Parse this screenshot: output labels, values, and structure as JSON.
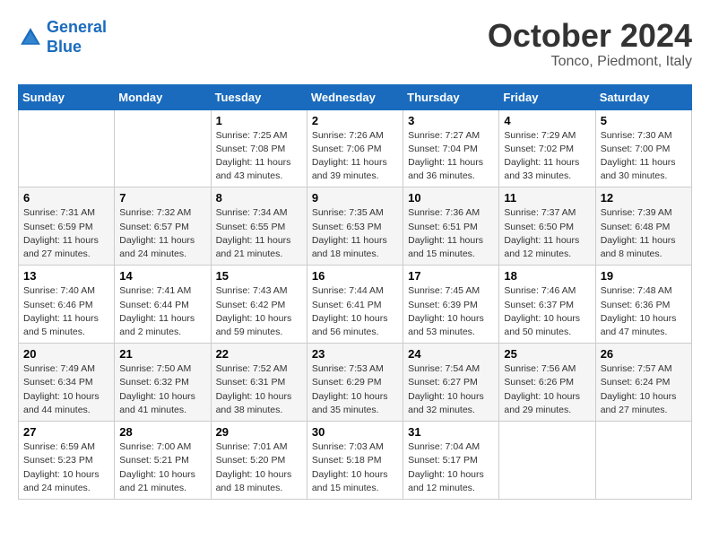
{
  "header": {
    "logo": {
      "line1": "General",
      "line2": "Blue"
    },
    "title": "October 2024",
    "location": "Tonco, Piedmont, Italy"
  },
  "weekdays": [
    "Sunday",
    "Monday",
    "Tuesday",
    "Wednesday",
    "Thursday",
    "Friday",
    "Saturday"
  ],
  "weeks": [
    [
      {
        "day": "",
        "info": ""
      },
      {
        "day": "",
        "info": ""
      },
      {
        "day": "1",
        "info": "Sunrise: 7:25 AM\nSunset: 7:08 PM\nDaylight: 11 hours and 43 minutes."
      },
      {
        "day": "2",
        "info": "Sunrise: 7:26 AM\nSunset: 7:06 PM\nDaylight: 11 hours and 39 minutes."
      },
      {
        "day": "3",
        "info": "Sunrise: 7:27 AM\nSunset: 7:04 PM\nDaylight: 11 hours and 36 minutes."
      },
      {
        "day": "4",
        "info": "Sunrise: 7:29 AM\nSunset: 7:02 PM\nDaylight: 11 hours and 33 minutes."
      },
      {
        "day": "5",
        "info": "Sunrise: 7:30 AM\nSunset: 7:00 PM\nDaylight: 11 hours and 30 minutes."
      }
    ],
    [
      {
        "day": "6",
        "info": "Sunrise: 7:31 AM\nSunset: 6:59 PM\nDaylight: 11 hours and 27 minutes."
      },
      {
        "day": "7",
        "info": "Sunrise: 7:32 AM\nSunset: 6:57 PM\nDaylight: 11 hours and 24 minutes."
      },
      {
        "day": "8",
        "info": "Sunrise: 7:34 AM\nSunset: 6:55 PM\nDaylight: 11 hours and 21 minutes."
      },
      {
        "day": "9",
        "info": "Sunrise: 7:35 AM\nSunset: 6:53 PM\nDaylight: 11 hours and 18 minutes."
      },
      {
        "day": "10",
        "info": "Sunrise: 7:36 AM\nSunset: 6:51 PM\nDaylight: 11 hours and 15 minutes."
      },
      {
        "day": "11",
        "info": "Sunrise: 7:37 AM\nSunset: 6:50 PM\nDaylight: 11 hours and 12 minutes."
      },
      {
        "day": "12",
        "info": "Sunrise: 7:39 AM\nSunset: 6:48 PM\nDaylight: 11 hours and 8 minutes."
      }
    ],
    [
      {
        "day": "13",
        "info": "Sunrise: 7:40 AM\nSunset: 6:46 PM\nDaylight: 11 hours and 5 minutes."
      },
      {
        "day": "14",
        "info": "Sunrise: 7:41 AM\nSunset: 6:44 PM\nDaylight: 11 hours and 2 minutes."
      },
      {
        "day": "15",
        "info": "Sunrise: 7:43 AM\nSunset: 6:42 PM\nDaylight: 10 hours and 59 minutes."
      },
      {
        "day": "16",
        "info": "Sunrise: 7:44 AM\nSunset: 6:41 PM\nDaylight: 10 hours and 56 minutes."
      },
      {
        "day": "17",
        "info": "Sunrise: 7:45 AM\nSunset: 6:39 PM\nDaylight: 10 hours and 53 minutes."
      },
      {
        "day": "18",
        "info": "Sunrise: 7:46 AM\nSunset: 6:37 PM\nDaylight: 10 hours and 50 minutes."
      },
      {
        "day": "19",
        "info": "Sunrise: 7:48 AM\nSunset: 6:36 PM\nDaylight: 10 hours and 47 minutes."
      }
    ],
    [
      {
        "day": "20",
        "info": "Sunrise: 7:49 AM\nSunset: 6:34 PM\nDaylight: 10 hours and 44 minutes."
      },
      {
        "day": "21",
        "info": "Sunrise: 7:50 AM\nSunset: 6:32 PM\nDaylight: 10 hours and 41 minutes."
      },
      {
        "day": "22",
        "info": "Sunrise: 7:52 AM\nSunset: 6:31 PM\nDaylight: 10 hours and 38 minutes."
      },
      {
        "day": "23",
        "info": "Sunrise: 7:53 AM\nSunset: 6:29 PM\nDaylight: 10 hours and 35 minutes."
      },
      {
        "day": "24",
        "info": "Sunrise: 7:54 AM\nSunset: 6:27 PM\nDaylight: 10 hours and 32 minutes."
      },
      {
        "day": "25",
        "info": "Sunrise: 7:56 AM\nSunset: 6:26 PM\nDaylight: 10 hours and 29 minutes."
      },
      {
        "day": "26",
        "info": "Sunrise: 7:57 AM\nSunset: 6:24 PM\nDaylight: 10 hours and 27 minutes."
      }
    ],
    [
      {
        "day": "27",
        "info": "Sunrise: 6:59 AM\nSunset: 5:23 PM\nDaylight: 10 hours and 24 minutes."
      },
      {
        "day": "28",
        "info": "Sunrise: 7:00 AM\nSunset: 5:21 PM\nDaylight: 10 hours and 21 minutes."
      },
      {
        "day": "29",
        "info": "Sunrise: 7:01 AM\nSunset: 5:20 PM\nDaylight: 10 hours and 18 minutes."
      },
      {
        "day": "30",
        "info": "Sunrise: 7:03 AM\nSunset: 5:18 PM\nDaylight: 10 hours and 15 minutes."
      },
      {
        "day": "31",
        "info": "Sunrise: 7:04 AM\nSunset: 5:17 PM\nDaylight: 10 hours and 12 minutes."
      },
      {
        "day": "",
        "info": ""
      },
      {
        "day": "",
        "info": ""
      }
    ]
  ]
}
